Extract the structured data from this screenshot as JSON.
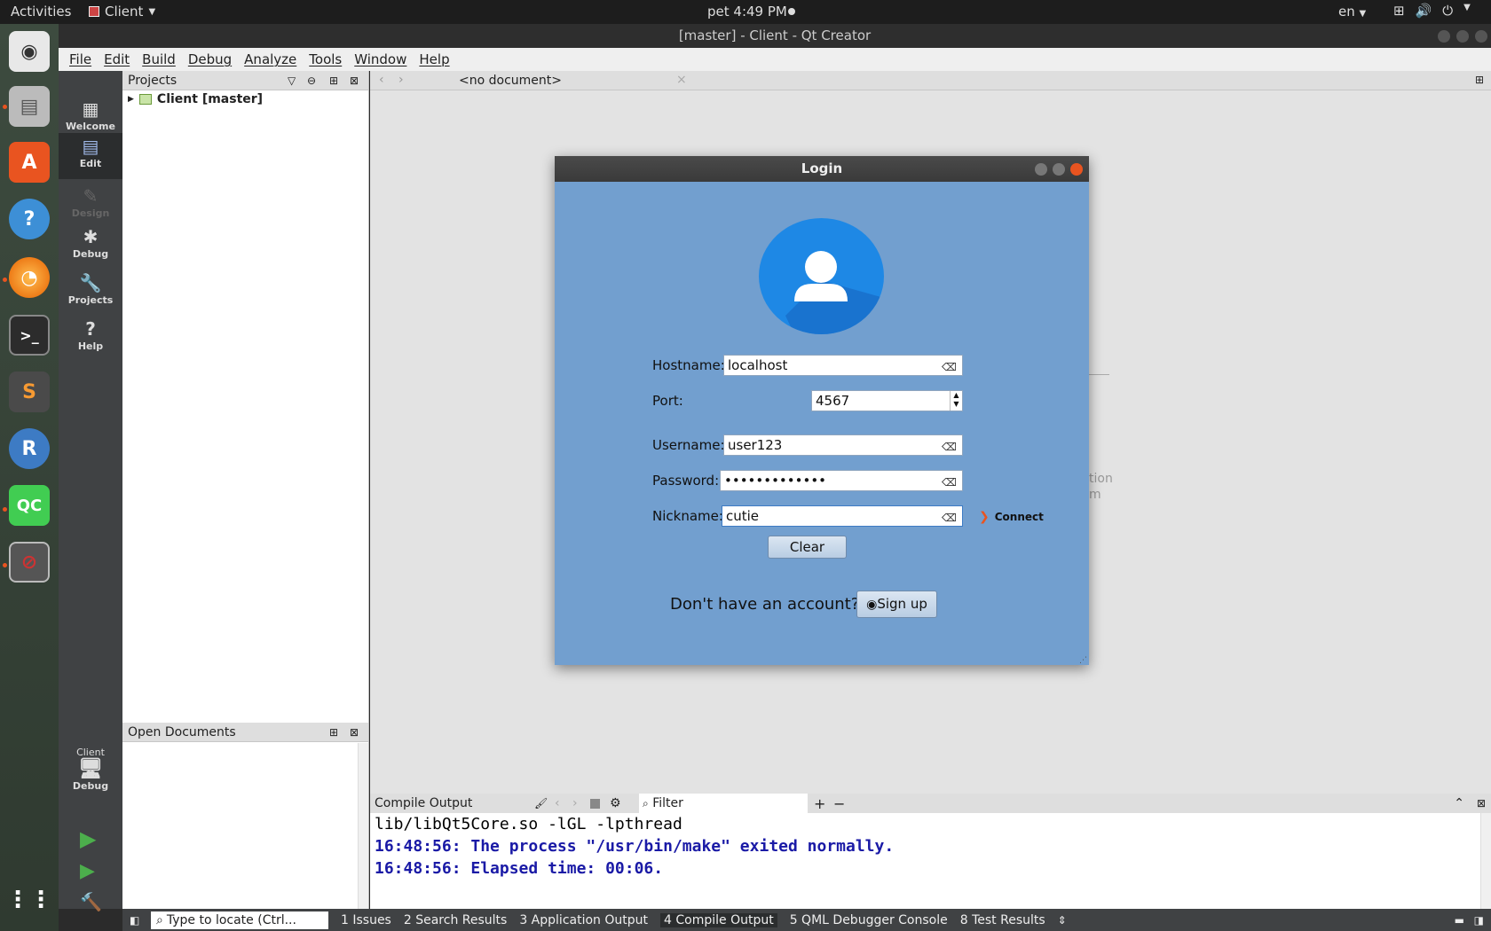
{
  "topbar": {
    "activities": "Activities",
    "app_name": "Client",
    "clock": "pet  4:49 PM",
    "lang": "en"
  },
  "window": {
    "title": "[master] - Client - Qt Creator"
  },
  "menu": [
    "File",
    "Edit",
    "Build",
    "Debug",
    "Analyze",
    "Tools",
    "Window",
    "Help"
  ],
  "modes": [
    {
      "label": "Welcome",
      "icon": "grid-icon"
    },
    {
      "label": "Edit",
      "icon": "document-icon"
    },
    {
      "label": "Design",
      "icon": "pencil-icon"
    },
    {
      "label": "Debug",
      "icon": "bug-icon"
    },
    {
      "label": "Projects",
      "icon": "wrench-icon"
    },
    {
      "label": "Help",
      "icon": "help-icon"
    }
  ],
  "kit": {
    "project": "Client",
    "config": "Debug"
  },
  "projects": {
    "header": "Projects",
    "tree_item": "Client [master]"
  },
  "open_documents": {
    "header": "Open Documents"
  },
  "editor": {
    "doc_selector": "<no document>",
    "behind_text_1": "tion",
    "behind_text_2": "m"
  },
  "output": {
    "header": "Compile Output",
    "filter_placeholder": "Filter",
    "lines": [
      "lib/libQt5Core.so -lGL -lpthread",
      "16:48:56: The process \"/usr/bin/make\" exited normally.",
      "16:48:56: Elapsed time: 00:06."
    ]
  },
  "statusbar": {
    "locate_placeholder": "Type to locate (Ctrl...",
    "tabs": [
      "1  Issues",
      "2  Search Results",
      "3  Application Output",
      "4  Compile Output",
      "5  QML Debugger Console",
      "8  Test Results"
    ]
  },
  "dialog": {
    "title": "Login",
    "hostname_label": "Hostname:",
    "hostname_value": "localhost",
    "port_label": "Port:",
    "port_value": "4567",
    "username_label": "Username:",
    "username_value": "user123",
    "password_label": "Password:",
    "password_value": "•••••••••••••",
    "nickname_label": "Nickname:",
    "nickname_value": "cutie",
    "connect_label": "Connect",
    "clear_label": "Clear",
    "no_account_text": "Don't have an account?",
    "signup_label": "Sign up"
  },
  "colors": {
    "dialog_bg": "#729fcf",
    "avatar": "#1e88e5",
    "output_blue": "#1a1aa6",
    "accent": "#e95420"
  }
}
